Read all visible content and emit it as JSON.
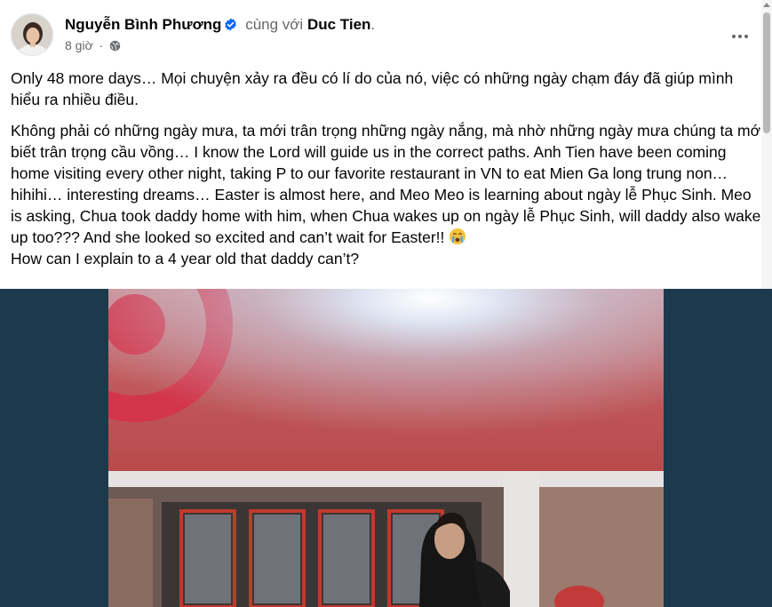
{
  "post": {
    "author": "Nguyễn Bình Phương",
    "with_text": "cùng với",
    "tagged": "Duc Tien",
    "tagged_suffix": ".",
    "timestamp": "8 giờ",
    "meta_dot": "·",
    "icons": {
      "verified": "verified-badge-icon",
      "privacy": "globe-icon",
      "more": "more-options-icon",
      "emoji": "crying-face-emoji"
    },
    "paragraph_1": "Only 48 more days… Mọi chuyện xảy ra đều có lí do của nó, việc có những ngày chạm đáy đã giúp mình hiểu ra nhiều điều.",
    "paragraph_2": "Không phải có những ngày mưa, ta mới trân trọng những ngày nắng, mà nhờ những ngày mưa chúng ta mới biết trân trọng cầu vồng… I know the Lord will guide us in the correct paths. Anh Tien have been coming home visiting every other night, taking P to our favorite restaurant in VN to eat Mien Ga long trung non… hihihi… interesting dreams…  Easter is almost here, and Meo Meo is learning about ngày lễ Phục Sinh. Meo is asking, Chua took daddy home with him, when Chua wakes up on ngày lễ Phục Sinh, will daddy also wake up too??? And she looked so excited and can’t wait for Easter!!",
    "paragraph_2_end": "How can I explain to a 4 year old that daddy can’t?",
    "colors": {
      "verified_blue": "#0866ff",
      "secondary_text": "#65676b",
      "media_background": "#1c3a4c",
      "target_red": "#d3364a",
      "storefront_red": "#b8484a"
    }
  }
}
